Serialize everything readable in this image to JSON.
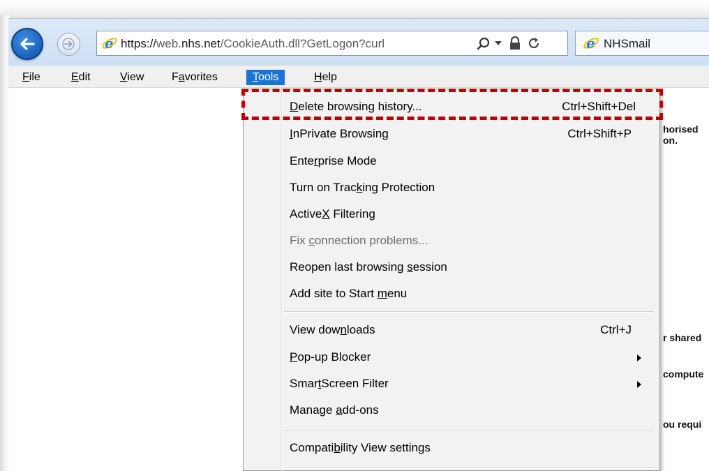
{
  "address_bar": {
    "url_prefix": "https://",
    "url_domain_pre": "web.",
    "url_domain": "nhs.net",
    "url_path": "/CookieAuth.dll?GetLogon?curl"
  },
  "tab": {
    "title": "NHSmail"
  },
  "menubar": {
    "file": {
      "u": "F",
      "rest": "ile"
    },
    "edit": {
      "u": "E",
      "rest": "dit"
    },
    "view": {
      "u": "V",
      "rest": "iew"
    },
    "favorites": {
      "pre": "F",
      "u": "a",
      "rest": "vorites"
    },
    "tools": {
      "u": "T",
      "rest": "ools"
    },
    "help": {
      "u": "H",
      "rest": "elp"
    }
  },
  "tools_menu": {
    "delete_history": {
      "u": "D",
      "rest": "elete browsing history...",
      "shortcut": "Ctrl+Shift+Del"
    },
    "inprivate": {
      "u": "I",
      "rest": "nPrivate Browsing",
      "shortcut": "Ctrl+Shift+P"
    },
    "enterprise": {
      "pre": "Ente",
      "u": "r",
      "rest": "prise Mode"
    },
    "tracking": {
      "pre": "Turn on Trac",
      "u": "k",
      "rest": "ing Protection"
    },
    "activex": {
      "pre": "Active",
      "u": "X",
      "rest": " Filtering"
    },
    "fix_connection": {
      "pre": "Fix ",
      "u": "c",
      "rest": "onnection problems..."
    },
    "reopen": {
      "pre": "Reopen last browsing ",
      "u": "s",
      "rest": "ession"
    },
    "add_site": {
      "pre": "Add site to Start ",
      "u": "m",
      "rest": "enu"
    },
    "downloads": {
      "pre": "View dow",
      "u": "n",
      "rest": "loads",
      "shortcut": "Ctrl+J"
    },
    "popup": {
      "u": "P",
      "rest": "op-up Blocker"
    },
    "smartscreen": {
      "pre": "Smar",
      "u": "t",
      "rest": "Screen Filter"
    },
    "addons": {
      "pre": "Manage ",
      "u": "a",
      "rest": "dd-ons"
    },
    "compat": {
      "pre": "Compati",
      "u": "b",
      "rest": "ility View settings"
    }
  },
  "page_fragments": {
    "f1": "horised",
    "f2": "on.",
    "f3": "r shared",
    "f4": "compute",
    "f5": "ou requi"
  },
  "colors": {
    "highlight": "#c00000",
    "menu_active": "#1e72d2",
    "ie_blue": "#1a62be"
  },
  "icons": [
    "back-arrow-icon",
    "forward-arrow-icon",
    "ie-logo-icon",
    "search-icon",
    "dropdown-icon",
    "lock-icon",
    "refresh-icon",
    "submenu-arrow-icon"
  ]
}
